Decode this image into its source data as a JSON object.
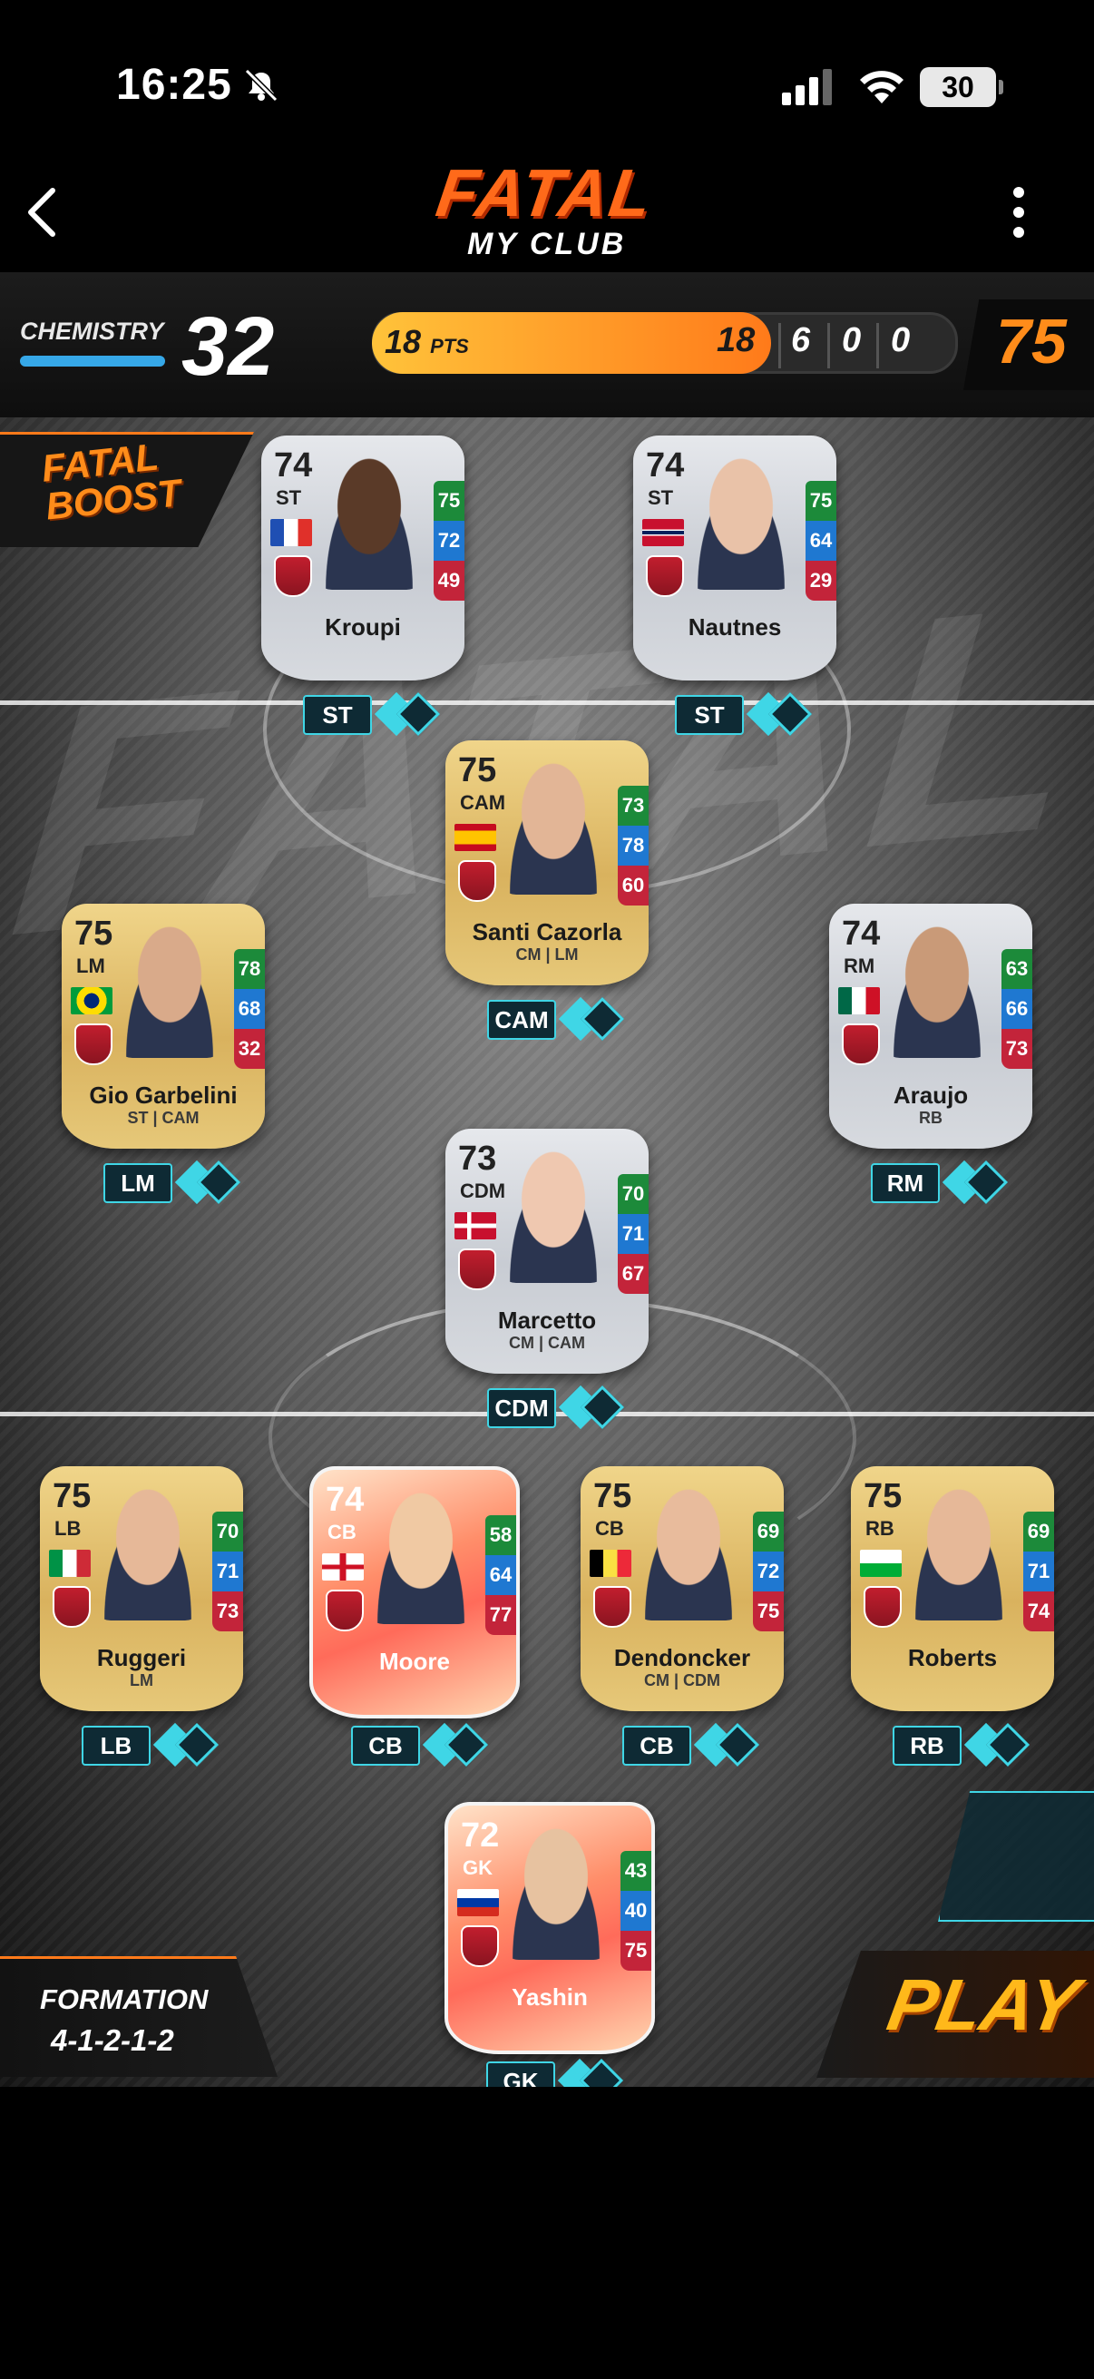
{
  "status": {
    "time": "16:25",
    "battery": "30"
  },
  "header": {
    "logo_title": "FATAL",
    "logo_subtitle": "MY CLUB"
  },
  "chemistry": {
    "label": "CHEMISTRY",
    "value": "32"
  },
  "points": {
    "value": "18",
    "unit": "PTS",
    "wins": "18",
    "draws": "6",
    "losses": "0",
    "other": "0"
  },
  "team_rating": "75",
  "boost": {
    "line1": "FATAL",
    "line2": "BOOST"
  },
  "background_text": "FATAL",
  "players": [
    {
      "id": "kroupi",
      "name": "Kroupi",
      "rating": "74",
      "position": "ST",
      "alt": "",
      "stats": [
        "75",
        "72",
        "49"
      ],
      "slot": "ST",
      "type": "silver"
    },
    {
      "id": "nautnes",
      "name": "Nautnes",
      "rating": "74",
      "position": "ST",
      "alt": "",
      "stats": [
        "75",
        "64",
        "29"
      ],
      "slot": "ST",
      "type": "silver"
    },
    {
      "id": "cazorla",
      "name": "Santi Cazorla",
      "rating": "75",
      "position": "CAM",
      "alt": "CM | LM",
      "stats": [
        "73",
        "78",
        "60"
      ],
      "slot": "CAM",
      "type": "gold"
    },
    {
      "id": "garbelini",
      "name": "Gio Garbelini",
      "rating": "75",
      "position": "LM",
      "alt": "ST | CAM",
      "stats": [
        "78",
        "68",
        "32"
      ],
      "slot": "LM",
      "type": "gold"
    },
    {
      "id": "araujo",
      "name": "Araujo",
      "rating": "74",
      "position": "RM",
      "alt": "RB",
      "stats": [
        "63",
        "66",
        "73"
      ],
      "slot": "RM",
      "type": "silver"
    },
    {
      "id": "marcetto",
      "name": "Marcetto",
      "rating": "73",
      "position": "CDM",
      "alt": "CM | CAM",
      "stats": [
        "70",
        "71",
        "67"
      ],
      "slot": "CDM",
      "type": "silver"
    },
    {
      "id": "ruggeri",
      "name": "Ruggeri",
      "rating": "75",
      "position": "LB",
      "alt": "LM",
      "stats": [
        "70",
        "71",
        "73"
      ],
      "slot": "LB",
      "type": "gold"
    },
    {
      "id": "moore",
      "name": "Moore",
      "rating": "74",
      "position": "CB",
      "alt": "",
      "stats": [
        "58",
        "64",
        "77"
      ],
      "slot": "CB",
      "type": "icon"
    },
    {
      "id": "dendoncker",
      "name": "Dendoncker",
      "rating": "75",
      "position": "CB",
      "alt": "CM | CDM",
      "stats": [
        "69",
        "72",
        "75"
      ],
      "slot": "CB",
      "type": "gold"
    },
    {
      "id": "roberts",
      "name": "Roberts",
      "rating": "75",
      "position": "RB",
      "alt": "",
      "stats": [
        "69",
        "71",
        "74"
      ],
      "slot": "RB",
      "type": "gold"
    },
    {
      "id": "yashin",
      "name": "Yashin",
      "rating": "72",
      "position": "GK",
      "alt": "",
      "stats": [
        "43",
        "40",
        "75"
      ],
      "slot": "GK",
      "type": "icon"
    }
  ],
  "formation": {
    "label": "FORMATION",
    "value": "4-1-2-1-2"
  },
  "play_label": "PLAY",
  "icons": {
    "back": "chevron-left-icon",
    "menu": "more-vertical-icon",
    "bell": "bell-off-icon",
    "signal": "signal-icon",
    "wifi": "wifi-icon"
  }
}
